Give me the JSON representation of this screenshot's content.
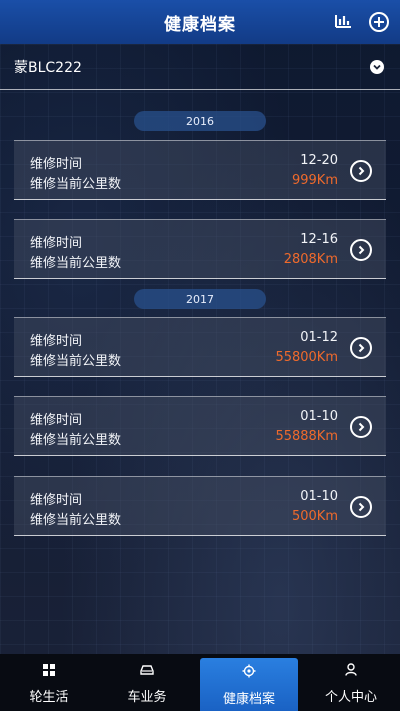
{
  "header": {
    "title": "健康档案"
  },
  "vehicle": {
    "plate": "蒙BLC222"
  },
  "groups": [
    {
      "year": "2016",
      "records": [
        {
          "label_time": "维修时间",
          "label_km": "维修当前公里数",
          "date": "12-20",
          "km": "999Km"
        },
        {
          "label_time": "维修时间",
          "label_km": "维修当前公里数",
          "date": "12-16",
          "km": "2808Km"
        }
      ]
    },
    {
      "year": "2017",
      "records": [
        {
          "label_time": "维修时间",
          "label_km": "维修当前公里数",
          "date": "01-12",
          "km": "55800Km"
        },
        {
          "label_time": "维修时间",
          "label_km": "维修当前公里数",
          "date": "01-10",
          "km": "55888Km"
        },
        {
          "label_time": "维修时间",
          "label_km": "维修当前公里数",
          "date": "01-10",
          "km": "500Km"
        }
      ]
    }
  ],
  "tabs": [
    {
      "label": "轮生活",
      "icon": "grid-icon"
    },
    {
      "label": "车业务",
      "icon": "car-icon"
    },
    {
      "label": "健康档案",
      "icon": "gear-icon",
      "active": true
    },
    {
      "label": "个人中心",
      "icon": "person-icon"
    }
  ],
  "colors": {
    "header": "#1a4fa8",
    "accent_km": "#ef6a2c",
    "active_tab": "#2a7fe0"
  }
}
